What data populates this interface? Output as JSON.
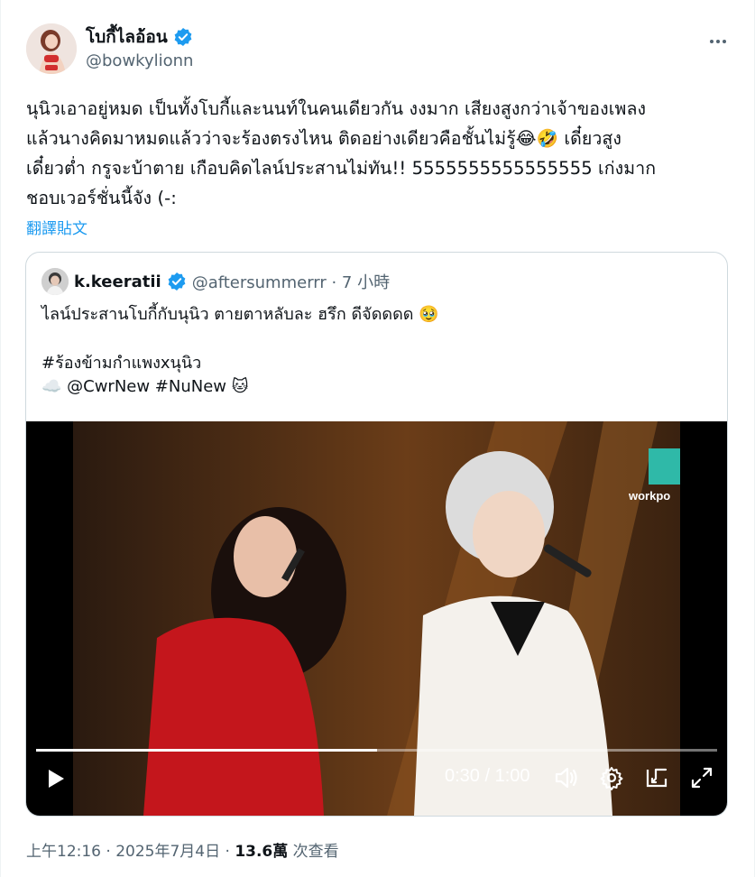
{
  "author": {
    "display_name": "โบกี้ไลอ้อน",
    "handle": "@bowkylionn"
  },
  "post": {
    "lines": [
      "นุนิวเอาอยู่หมด เป็นทั้งโบกี้และนนท์ในคนเดียวกัน งงมาก เสียงสูงกว่าเจ้าของเพลง",
      "แล้วนางคิดมาหมดแล้วว่าจะร้องตรงไหน ติดอย่างเดียวคือชั้นไม่รู้😂🤣 เดี๋ยวสูง",
      "เดี๋ยวต่ำ กรูจะบ้าตาย เกือบคิดไลน์ประสานไม่ทัน!! 5555555555555555 เก่งมาก",
      "ชอบเวอร์ชั่นนี้จัง (-:"
    ],
    "translate_label": "翻譯貼文"
  },
  "quote": {
    "display_name": "k.keeratii",
    "handle_time": "@aftersummerrr · 7 小時",
    "lines": [
      "ไลน์ประสานโบกี้กับนุนิว ตายตาหลับละ ฮรึก ดีจัดดดด 🥹"
    ],
    "hashtag_line": "#ร้องข้ามกำแพงxนุนิว",
    "mention_line": "☁️ @CwrNew #NuNew 🐱"
  },
  "video": {
    "time_label": "0:30 / 1:00",
    "progress": 0.5,
    "brand_text": "workpo"
  },
  "footer": {
    "timestamp": "上午12:16 · 2025年7月4日 · ",
    "views_count": "13.6萬",
    "views_label": " 次查看"
  },
  "colors": {
    "accent": "#1d9bf0",
    "text": "#0f1419",
    "muted": "#536471"
  }
}
